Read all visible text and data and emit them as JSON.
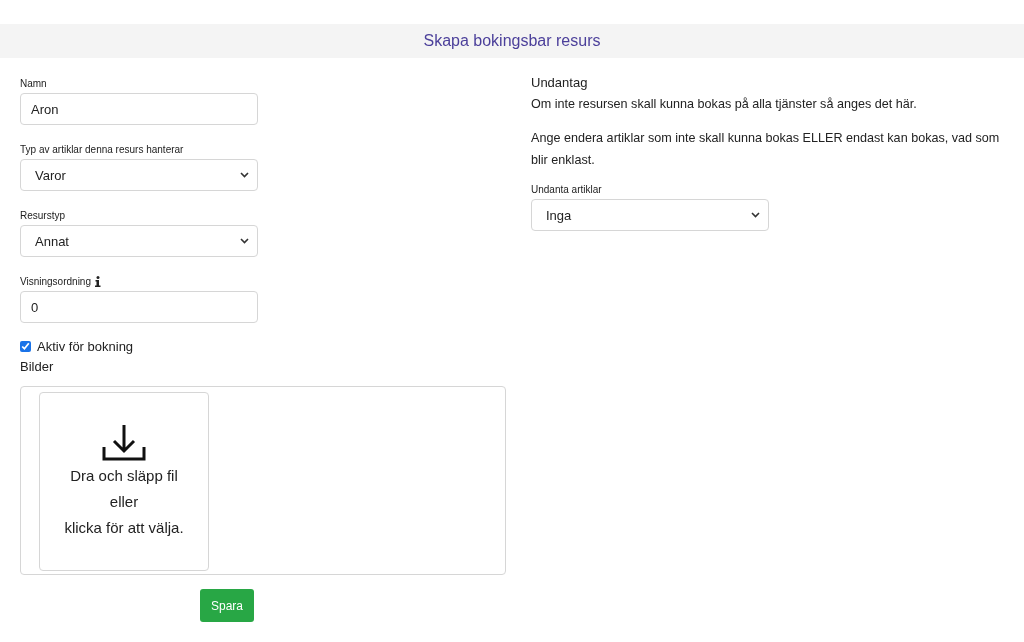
{
  "header": {
    "title": "Skapa bokingsbar resurs"
  },
  "form": {
    "fields": [
      {
        "kind": "text",
        "label": "Namn",
        "value": "Aron",
        "info": false
      },
      {
        "kind": "select",
        "label": "Typ av artiklar denna resurs hanterar",
        "value": "Varor",
        "info": false
      },
      {
        "kind": "select",
        "label": "Resurstyp",
        "value": "Annat",
        "info": false
      },
      {
        "kind": "text",
        "label": "Visningsordning",
        "value": "0",
        "info": true
      }
    ],
    "checkbox": {
      "label": "Aktiv för bokning",
      "checked": true
    },
    "images": {
      "label": "Bilder",
      "dropzone_lines": [
        "Dra och släpp fil",
        "eller",
        "klicka för att välja."
      ]
    },
    "save_button": "Spara"
  },
  "exceptions": {
    "title": "Undantag",
    "paragraphs": [
      "Om inte resursen skall kunna bokas på alla tjänster så anges det här.",
      "Ange endera artiklar som inte skall kunna bokas ELLER endast kan bokas, vad som blir enklast."
    ],
    "field": {
      "kind": "select",
      "label": "Undanta artiklar",
      "value": "Inga"
    }
  }
}
